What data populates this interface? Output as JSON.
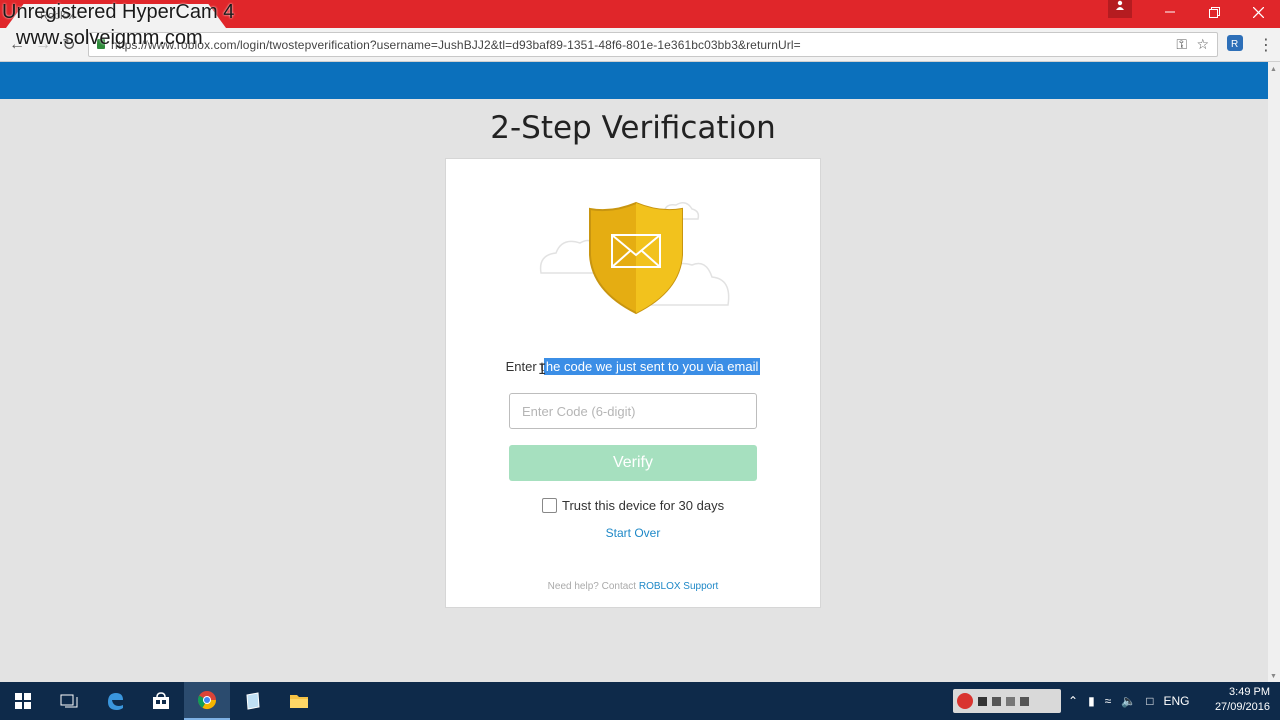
{
  "browser": {
    "tab_title": "Roblox",
    "url": "https://www.roblox.com/login/twostepverification?username=JushBJJ2&tl=d93baf89-1351-48f6-801e-1e361bc03bb3&returnUrl=",
    "accent_color": "#e0262a"
  },
  "watermark": {
    "line1": "Unregistered HyperCam 4",
    "line2": "www.solveigmm.com"
  },
  "page": {
    "header_color": "#0b70bc",
    "title": "2-Step Verification",
    "prompt_prefix": "Enter t",
    "prompt_selected": "he code we just sent to you via email",
    "code_placeholder": "Enter Code (6-digit)",
    "verify_label": "Verify",
    "verify_color": "#a6e0bf",
    "trust_label": "Trust this device for 30 days",
    "trust_checked": false,
    "start_over_label": "Start Over",
    "help_prefix": "Need help? Contact ",
    "help_link": "ROBLOX Support"
  },
  "taskbar": {
    "language": "ENG",
    "time": "3:49 PM",
    "date": "27/09/2016",
    "apps": [
      "start-icon",
      "task-view-icon",
      "edge-icon",
      "store-icon",
      "chrome-icon",
      "notepad-icon",
      "file-explorer-icon"
    ]
  }
}
